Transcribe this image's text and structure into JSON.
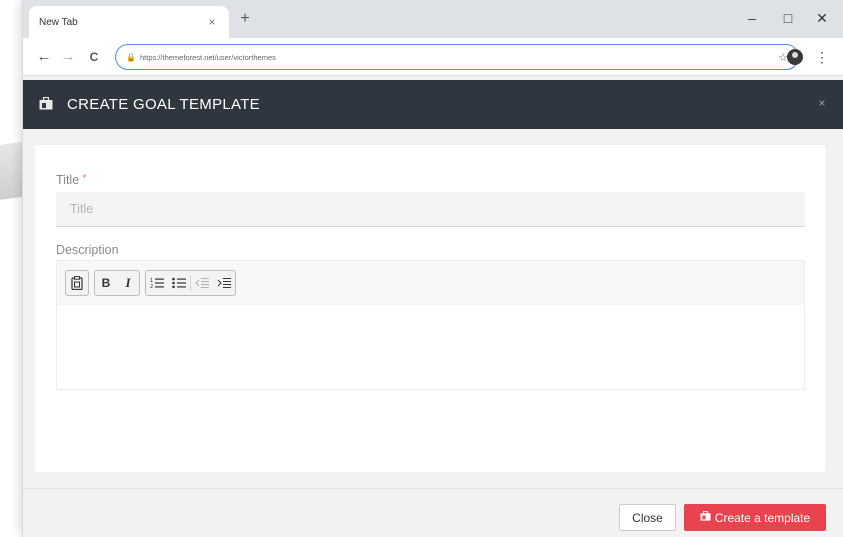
{
  "browser": {
    "tab_title": "New Tab",
    "tab_close": "×",
    "new_tab": "+",
    "url": "https://themeforest.net/user/victorthemes",
    "controls": {
      "minimize": "–",
      "maximize": "□",
      "close": "✕"
    },
    "nav": {
      "back": "←",
      "forward": "→",
      "reload": "C"
    }
  },
  "modal": {
    "title": "CREATE GOAL TEMPLATE",
    "close_glyph": "×",
    "fields": {
      "title_label": "Title",
      "title_required": "*",
      "title_placeholder": "Title",
      "description_label": "Description"
    },
    "toolbar": {
      "bold": "B",
      "italic": "I",
      "ordered_list": "⁝≡",
      "unordered_list": "⁝≡",
      "outdent": "⇤",
      "indent": "⇥"
    },
    "footer": {
      "close_label": "Close",
      "create_label": "Create a template"
    }
  },
  "colors": {
    "header_bg": "#2f3640",
    "primary": "#e8434f",
    "body_bg": "#f2f2f2"
  }
}
